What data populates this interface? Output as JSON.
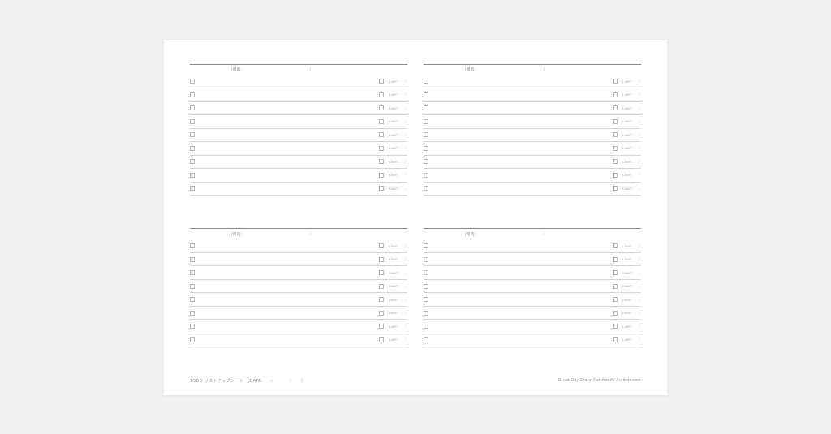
{
  "section_header": {
    "label": "（目的：",
    "closing": "）"
  },
  "row": {
    "limit_label": "LIMIT",
    "limit_sep": "/"
  },
  "section_row_counts": [
    9,
    9,
    8,
    8
  ],
  "footer": {
    "left_prefix": "TODO リストアップシート （DATE",
    "left_sep": "/",
    "left_close": "）",
    "right": "Good Day Diary ©eichimihi / mihiri.com"
  }
}
